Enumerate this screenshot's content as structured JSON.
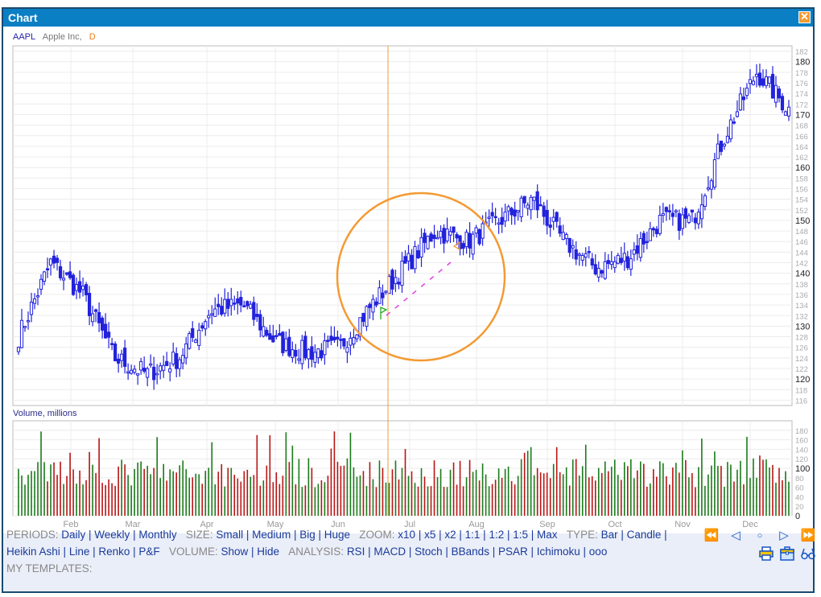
{
  "window": {
    "title": "Chart",
    "close_icon": "close-icon"
  },
  "header": {
    "symbol": "AAPL",
    "company": "Apple Inc,",
    "period": "D"
  },
  "volume_label": "Volume, millions",
  "chart_data": [
    {
      "type": "candlestick",
      "title": "AAPL Apple Inc, D",
      "x_tick_labels": [
        "Feb",
        "Mar",
        "Apr",
        "May",
        "Jun",
        "Jul",
        "Aug",
        "Sep",
        "Oct",
        "Nov",
        "Dec"
      ],
      "y_tick_labels": [
        "116",
        "118",
        "120",
        "122",
        "124",
        "126",
        "128",
        "130",
        "132",
        "134",
        "136",
        "138",
        "140",
        "142",
        "144",
        "146",
        "148",
        "150",
        "152",
        "154",
        "156",
        "158",
        "160",
        "162",
        "164",
        "166",
        "168",
        "170",
        "172",
        "174",
        "176",
        "178",
        "180",
        "182"
      ],
      "ylim": [
        115,
        183
      ],
      "grid": true,
      "close_keypoints": [
        {
          "month": "Jan",
          "close": 128
        },
        {
          "month": "Jan-late",
          "close": 142
        },
        {
          "month": "Feb",
          "close": 136
        },
        {
          "month": "Feb-late",
          "close": 124
        },
        {
          "month": "Mar",
          "close": 121
        },
        {
          "month": "Mar-late",
          "close": 124
        },
        {
          "month": "Apr",
          "close": 133
        },
        {
          "month": "Apr-late",
          "close": 134
        },
        {
          "month": "May",
          "close": 127
        },
        {
          "month": "May-late",
          "close": 125
        },
        {
          "month": "Jun",
          "close": 126
        },
        {
          "month": "Jun-late",
          "close": 134
        },
        {
          "month": "Jul",
          "close": 141
        },
        {
          "month": "Jul-late",
          "close": 148
        },
        {
          "month": "Aug",
          "close": 146
        },
        {
          "month": "Aug-late",
          "close": 150
        },
        {
          "month": "Sep",
          "close": 154
        },
        {
          "month": "Sep-late",
          "close": 146
        },
        {
          "month": "Oct",
          "close": 141
        },
        {
          "month": "Oct-late",
          "close": 143
        },
        {
          "month": "Nov",
          "close": 150
        },
        {
          "month": "Nov-late",
          "close": 150
        },
        {
          "month": "Dec",
          "close": 166
        },
        {
          "month": "Dec-late",
          "close": 178
        },
        {
          "month": "Dec-end",
          "close": 171
        }
      ],
      "annotations": [
        {
          "type": "vertical-line",
          "date": "Jun-late",
          "color": "#f39a32"
        },
        {
          "type": "circle",
          "center_price": 140,
          "color": "#f39a32"
        },
        {
          "type": "trendline",
          "from_price": 133,
          "to_price": 145,
          "color": "#e040e0",
          "style": "dashed"
        },
        {
          "type": "marker",
          "shape": "flag-triangle",
          "price": 134,
          "color": "#22aa22"
        },
        {
          "type": "marker",
          "shape": "triangle-left",
          "price": 145,
          "color": "#f39a32"
        }
      ],
      "colors": {
        "candle": "#2222dd",
        "grid": "#e8e8e8"
      }
    },
    {
      "type": "bar",
      "title": "Volume, millions",
      "y_tick_labels": [
        "0",
        "20",
        "40",
        "60",
        "80",
        "100",
        "120",
        "140",
        "160",
        "180"
      ],
      "ylim": [
        0,
        200
      ],
      "colors": {
        "up": "#1a7a1a",
        "down": "#b81414"
      },
      "note": "approx 240 daily bars, typical 70-120, spikes to ~195"
    }
  ],
  "bottom": {
    "row1": {
      "periods_label": "PERIODS:",
      "periods": [
        "Daily",
        "Weekly",
        "Monthly"
      ],
      "size_label": "SIZE:",
      "sizes": [
        "Small",
        "Medium",
        "Big",
        "Huge"
      ],
      "zoom_label": "ZOOM:",
      "zooms": [
        "x10",
        "x5",
        "x2",
        "1:1",
        "1:2",
        "1:5",
        "Max"
      ],
      "type_label": "TYPE:",
      "types": [
        "Bar",
        "Candle"
      ]
    },
    "row2": {
      "types_cont": [
        "Heikin Ashi",
        "Line",
        "Renko",
        "P&F"
      ],
      "volume_label": "VOLUME:",
      "volume": [
        "Show",
        "Hide"
      ],
      "analysis_label": "ANALYSIS:",
      "analysis": [
        "RSI",
        "MACD",
        "Stoch",
        "BBands",
        "PSAR",
        "Ichimoku",
        "ooo"
      ]
    },
    "row3": {
      "templates_label": "MY TEMPLATES:"
    },
    "nav_icons": [
      "rewind-start-icon",
      "step-back-icon",
      "reset-icon",
      "step-forward-icon",
      "fast-forward-end-icon"
    ],
    "tool_icons": [
      "print-icon",
      "briefcase-icon",
      "glasses-icon"
    ]
  }
}
